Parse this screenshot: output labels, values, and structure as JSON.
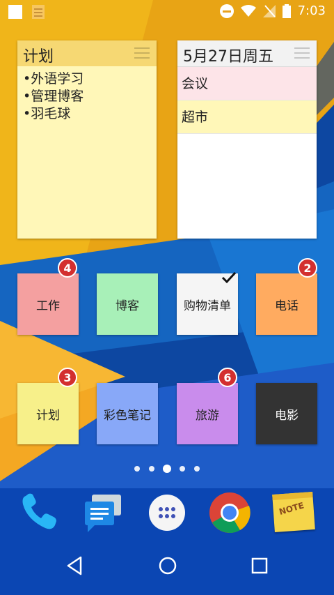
{
  "status_bar": {
    "time": "7:03"
  },
  "widgets": {
    "plan": {
      "title": "计划",
      "items": [
        "•外语学习",
        "•管理博客",
        "•羽毛球"
      ]
    },
    "calendar": {
      "title": "5月27日周五",
      "events": [
        "会议",
        "超市"
      ]
    }
  },
  "shortcuts": [
    {
      "label": "工作",
      "badge": "4",
      "color": "#f4a0a0"
    },
    {
      "label": "博客",
      "badge": "",
      "color": "#a8f0b8"
    },
    {
      "label": "购物清单",
      "badge": "",
      "color": "#f5f5f5",
      "checked": true
    },
    {
      "label": "电话",
      "badge": "2",
      "color": "#ffab60"
    },
    {
      "label": "计划",
      "badge": "3",
      "color": "#f7f08a"
    },
    {
      "label": "彩色笔记",
      "badge": "",
      "color": "#88a8f8"
    },
    {
      "label": "旅游",
      "badge": "6",
      "color": "#c98cec"
    },
    {
      "label": "电影",
      "badge": "",
      "color": "#333333"
    }
  ],
  "page_indicator": {
    "count": 5,
    "active_index": 2
  },
  "dock": [
    "phone-app",
    "messages-app",
    "app-drawer",
    "chrome-app",
    "notes-app"
  ],
  "dock_labels": {
    "note_icon_text": "NOTE"
  }
}
